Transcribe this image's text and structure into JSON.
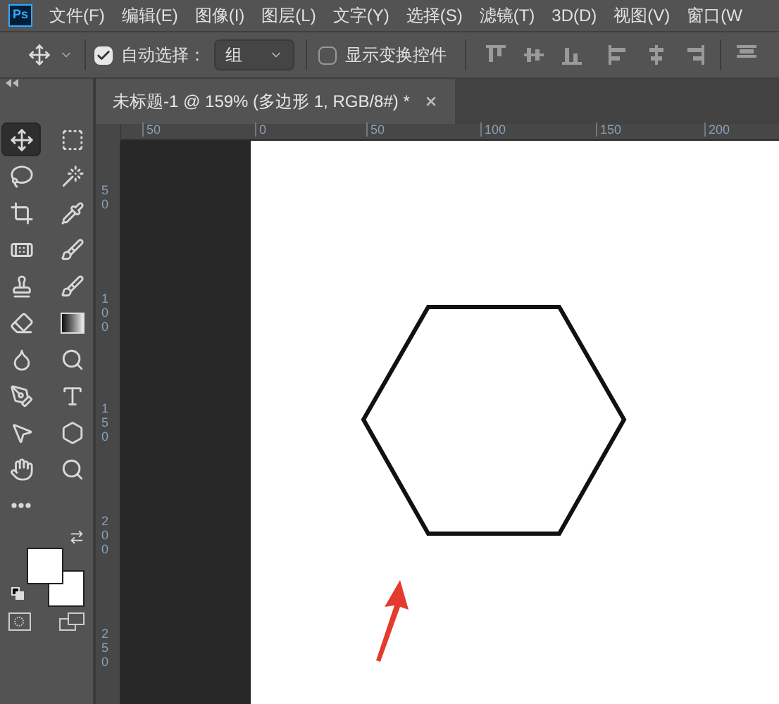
{
  "app": {
    "logo": "Ps"
  },
  "menu": [
    "文件(F)",
    "编辑(E)",
    "图像(I)",
    "图层(L)",
    "文字(Y)",
    "选择(S)",
    "滤镜(T)",
    "3D(D)",
    "视图(V)",
    "窗口(W"
  ],
  "options_bar": {
    "auto_select": {
      "label": "自动选择：",
      "checked": true
    },
    "target": {
      "value": "组"
    },
    "show_transform": {
      "label": "显示变换控件",
      "checked": false
    }
  },
  "document_tab": {
    "title": "未标题-1 @ 159% (多边形 1, RGB/8#) *"
  },
  "tools": [
    {
      "kind": "move",
      "selected": true
    },
    {
      "kind": "marquee",
      "selected": false
    },
    {
      "kind": "lasso",
      "selected": false
    },
    {
      "kind": "wand",
      "selected": false
    },
    {
      "kind": "crop",
      "selected": false
    },
    {
      "kind": "eyedropper",
      "selected": false
    },
    {
      "kind": "healing",
      "selected": false
    },
    {
      "kind": "brush",
      "selected": false
    },
    {
      "kind": "stamp",
      "selected": false
    },
    {
      "kind": "history",
      "selected": false
    },
    {
      "kind": "eraser",
      "selected": false
    },
    {
      "kind": "gradient",
      "selected": false
    },
    {
      "kind": "blur",
      "selected": false
    },
    {
      "kind": "dodge",
      "selected": false
    },
    {
      "kind": "pen",
      "selected": false
    },
    {
      "kind": "type",
      "selected": false
    },
    {
      "kind": "path_select",
      "selected": false
    },
    {
      "kind": "shape",
      "selected": false
    },
    {
      "kind": "hand",
      "selected": false
    },
    {
      "kind": "zoom",
      "selected": false
    },
    {
      "kind": "more",
      "selected": false
    }
  ],
  "ruler_h": [
    "50",
    "0",
    "50",
    "100",
    "150",
    "200"
  ],
  "ruler_v": [
    "50",
    "100",
    "150",
    "200",
    "250"
  ]
}
